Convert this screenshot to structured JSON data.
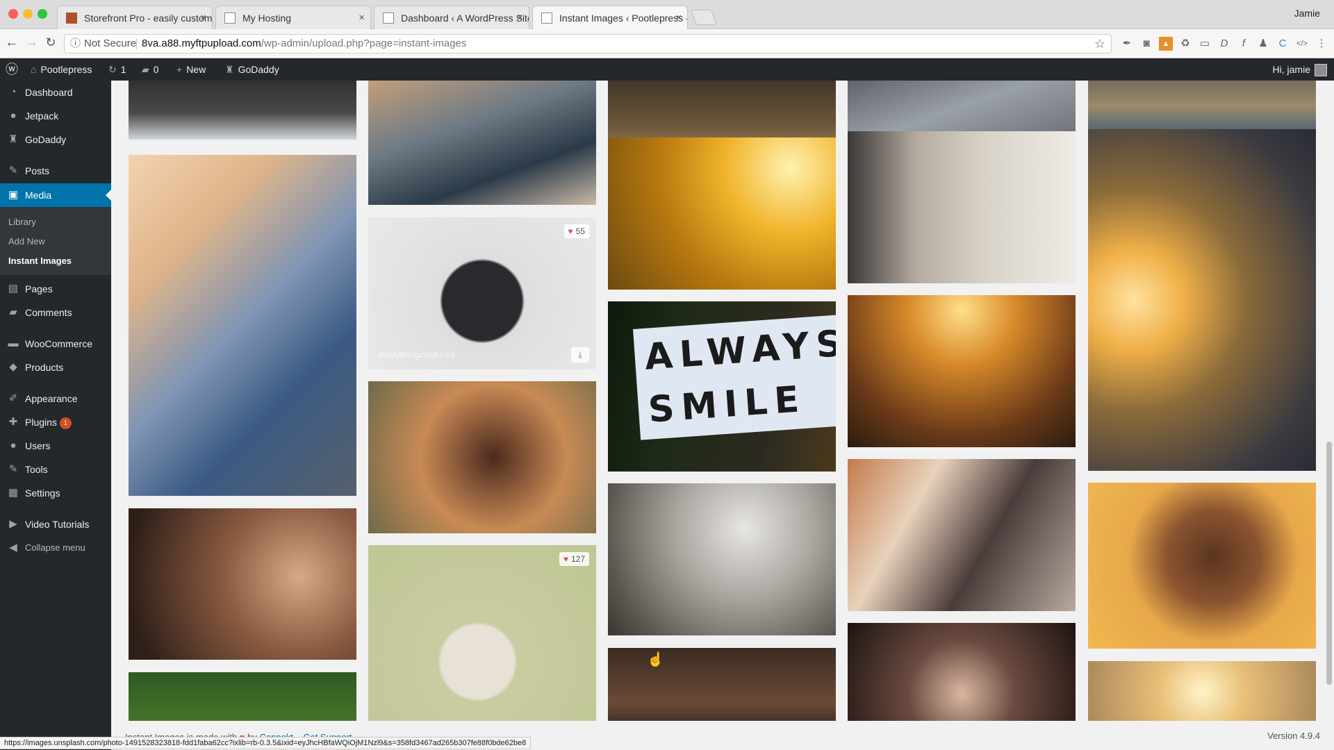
{
  "browser": {
    "tabs": [
      {
        "title": "Storefront Pro - easily custom",
        "favicon_color": "#b0502a",
        "active": false
      },
      {
        "title": "My Hosting",
        "favicon_color": "#999999",
        "active": false
      },
      {
        "title": "Dashboard ‹ A WordPress Site",
        "favicon_color": "#999999",
        "active": false
      },
      {
        "title": "Instant Images ‹ Pootlepress –",
        "favicon_color": "#999999",
        "active": true
      }
    ],
    "profile_name": "Jamie",
    "security_label": "Not Secure",
    "url_host": "8va.a88.myftpupload.com",
    "url_path": "/wp-admin/upload.php?page=instant-images",
    "status_url": "https://images.unsplash.com/photo-1491528323818-fdd1faba62cc?ixlib=rb-0.3.5&ixid=eyJhcHBfaWQiOjM1Nzl9&s=358fd3467ad265b307fe88f0bde62be8"
  },
  "adminbar": {
    "site_name": "Pootlepress",
    "updates_count": "1",
    "comments_count": "0",
    "new_label": "New",
    "godaddy_label": "GoDaddy",
    "greeting": "Hi, jamie"
  },
  "sidebar": {
    "items": [
      {
        "label": "Dashboard",
        "icon": "dashboard-icon",
        "glyph": "◔"
      },
      {
        "label": "Jetpack",
        "icon": "jetpack-icon",
        "glyph": "●"
      },
      {
        "label": "GoDaddy",
        "icon": "godaddy-icon",
        "glyph": "♜"
      },
      {
        "label": "Posts",
        "icon": "pin-icon",
        "glyph": "✎"
      },
      {
        "label": "Media",
        "icon": "media-icon",
        "glyph": "▣"
      },
      {
        "label": "Pages",
        "icon": "pages-icon",
        "glyph": "▤"
      },
      {
        "label": "Comments",
        "icon": "comment-icon",
        "glyph": "▰"
      },
      {
        "label": "WooCommerce",
        "icon": "woocommerce-icon",
        "glyph": "▬"
      },
      {
        "label": "Products",
        "icon": "products-icon",
        "glyph": "◆"
      },
      {
        "label": "Appearance",
        "icon": "brush-icon",
        "glyph": "✐"
      },
      {
        "label": "Plugins",
        "icon": "plug-icon",
        "glyph": "✚",
        "badge": "1"
      },
      {
        "label": "Users",
        "icon": "users-icon",
        "glyph": "●"
      },
      {
        "label": "Tools",
        "icon": "wrench-icon",
        "glyph": "✎"
      },
      {
        "label": "Settings",
        "icon": "settings-icon",
        "glyph": "▦"
      },
      {
        "label": "Video Tutorials",
        "icon": "video-icon",
        "glyph": "▶"
      }
    ],
    "media_submenu": [
      "Library",
      "Add New",
      "Instant Images"
    ],
    "collapse_label": "Collapse menu"
  },
  "gallery": {
    "like_badges": [
      "55",
      "127"
    ],
    "photo_credit": "everythingcaptured",
    "sign_lines": [
      "ALWAYS",
      "SMILE"
    ]
  },
  "footer": {
    "made_with_prefix": "Instant Images is made with",
    "by_label": "by",
    "author_link": "Connekt",
    "support_link": "Get Support",
    "version": "Version 4.9.4"
  }
}
